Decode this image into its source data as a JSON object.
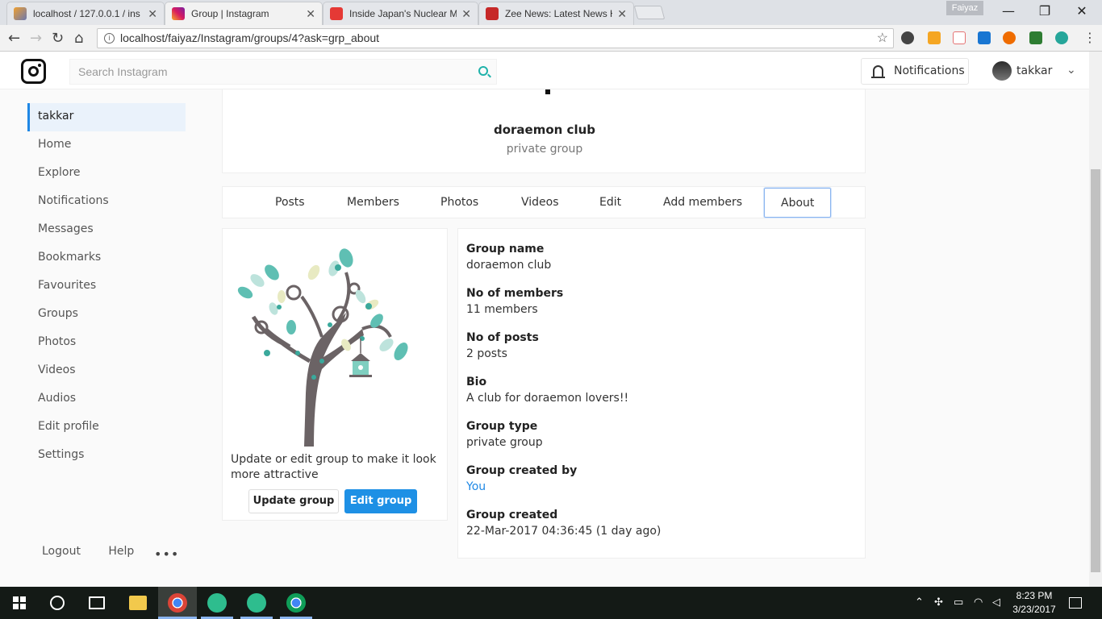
{
  "browser": {
    "tabs": [
      {
        "title": "localhost / 127.0.0.1 / ins",
        "active": false
      },
      {
        "title": "Group | Instagram",
        "active": true
      },
      {
        "title": "Inside Japan's Nuclear M",
        "active": false
      },
      {
        "title": "Zee News: Latest News H",
        "active": false
      }
    ],
    "profile_name": "Faiyaz",
    "url": "localhost/faiyaz/Instagram/groups/4?ask=grp_about"
  },
  "header": {
    "search_placeholder": "Search Instagram",
    "notifications_label": "Notifications",
    "username": "takkar"
  },
  "sidebar": {
    "items": [
      {
        "label": "takkar",
        "active": true
      },
      {
        "label": "Home"
      },
      {
        "label": "Explore"
      },
      {
        "label": "Notifications"
      },
      {
        "label": "Messages"
      },
      {
        "label": "Bookmarks"
      },
      {
        "label": "Favourites"
      },
      {
        "label": "Groups"
      },
      {
        "label": "Photos"
      },
      {
        "label": "Videos"
      },
      {
        "label": "Audios"
      },
      {
        "label": "Edit profile"
      },
      {
        "label": "Settings"
      }
    ],
    "footer": {
      "logout": "Logout",
      "help": "Help",
      "more": "•••"
    }
  },
  "group": {
    "name": "doraemon club",
    "type_label": "private group",
    "tabs": [
      "Posts",
      "Members",
      "Photos",
      "Videos",
      "Edit",
      "Add members",
      "About"
    ],
    "active_tab": "About",
    "promo_text": "Update or edit group to make it look more attractive",
    "update_button": "Update group",
    "edit_button": "Edit group",
    "about": [
      {
        "label": "Group name",
        "value": "doraemon club"
      },
      {
        "label": "No of members",
        "value": "11 members"
      },
      {
        "label": "No of posts",
        "value": "2 posts"
      },
      {
        "label": "Bio",
        "value": "A club for doraemon lovers!!"
      },
      {
        "label": "Group type",
        "value": "private group"
      },
      {
        "label": "Group created by",
        "value": "You",
        "link": true
      },
      {
        "label": "Group created",
        "value": "22-Mar-2017 04:36:45 (1 day ago)"
      }
    ]
  },
  "taskbar": {
    "time": "8:23 PM",
    "date": "3/23/2017"
  },
  "colors": {
    "accent": "#1e90e5",
    "teal": "#20b2aa",
    "tree_trunk": "#6b6365",
    "taskbar": "#141a16"
  }
}
